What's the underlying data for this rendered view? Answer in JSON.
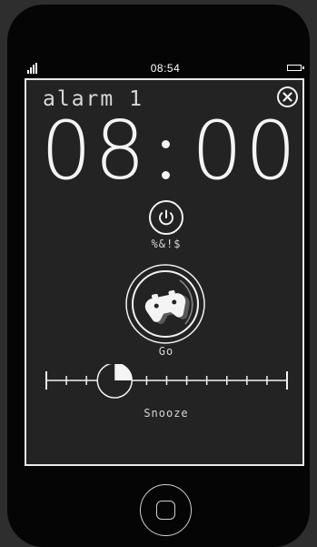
{
  "status_bar": {
    "time": "08:54",
    "signal_icon": "signal-strength-icon",
    "battery_icon": "battery-icon"
  },
  "alarm": {
    "name": "alarm 1",
    "hour_tens": "0",
    "hour_ones": "8",
    "minute_tens": "0",
    "minute_ones": "0",
    "time_separator": ":"
  },
  "controls": {
    "close_icon": "close-icon",
    "power_icon": "power-icon",
    "power_label": "%&!$",
    "game_icon": "gamepad-icon",
    "game_label": "Go",
    "snooze_label": "Snooze",
    "snooze_ticks": 13,
    "snooze_selected_index": 3,
    "snooze_knob_fill": 0.25
  },
  "colors": {
    "background": "#232323",
    "foreground": "#f4f4f4",
    "phone_body": "#050505"
  }
}
